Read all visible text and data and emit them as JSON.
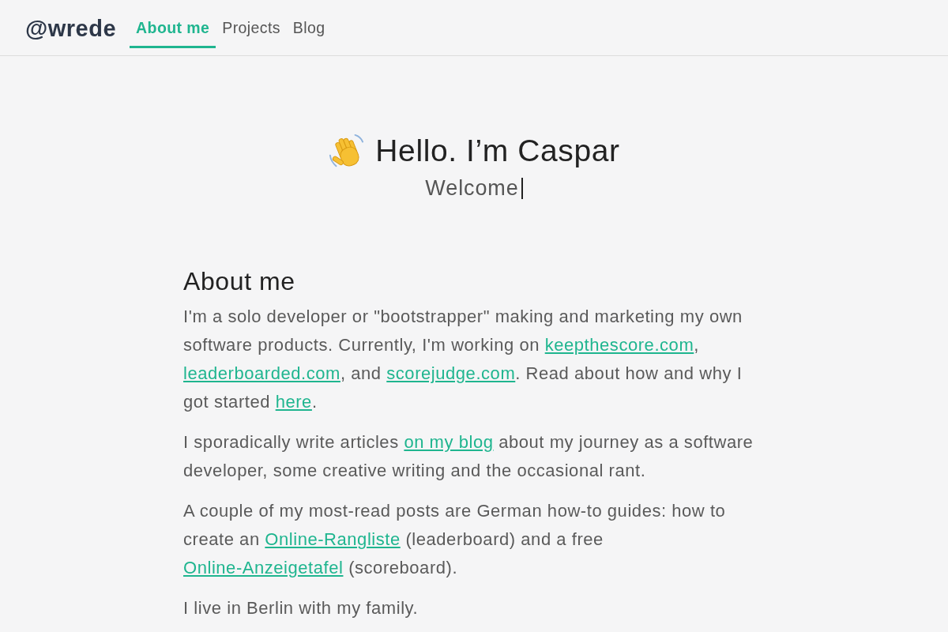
{
  "header": {
    "logo": "@wrede",
    "nav": [
      {
        "label": "About me",
        "selected": true
      },
      {
        "label": "Projects",
        "selected": false
      },
      {
        "label": "Blog",
        "selected": false
      }
    ]
  },
  "hero": {
    "title": "Hello. I’m Caspar",
    "subtitle": "Welcome"
  },
  "about": {
    "heading": "About me",
    "paragraphs": [
      [
        {
          "kind": "text",
          "text": "I'm a solo developer or \"bootstrapper\" making and marketing my own software products. Currently, I'm working on "
        },
        {
          "kind": "link",
          "text": "keepthescore.com"
        },
        {
          "kind": "text",
          "text": ", "
        },
        {
          "kind": "link",
          "text": "leaderboarded.com"
        },
        {
          "kind": "text",
          "text": ", and "
        },
        {
          "kind": "link",
          "text": "scorejudge.com"
        },
        {
          "kind": "text",
          "text": ". Read about how and why I got started "
        },
        {
          "kind": "link",
          "text": "here"
        },
        {
          "kind": "text",
          "text": "."
        }
      ],
      [
        {
          "kind": "text",
          "text": "I sporadically write articles "
        },
        {
          "kind": "link",
          "text": "on my blog"
        },
        {
          "kind": "text",
          "text": " about my journey as a software developer, some creative writing and the occasional rant."
        }
      ],
      [
        {
          "kind": "text",
          "text": "A couple of my most-read posts are German how-to guides: how to create an "
        },
        {
          "kind": "link",
          "text": "Online-Rangliste"
        },
        {
          "kind": "text",
          "text": " (leaderboard) and a free "
        },
        {
          "kind": "link",
          "text": "Online-Anzeigetafel"
        },
        {
          "kind": "text",
          "text": " (scoreboard)."
        }
      ],
      [
        {
          "kind": "text",
          "text": "I live in Berlin with my family."
        }
      ]
    ]
  }
}
